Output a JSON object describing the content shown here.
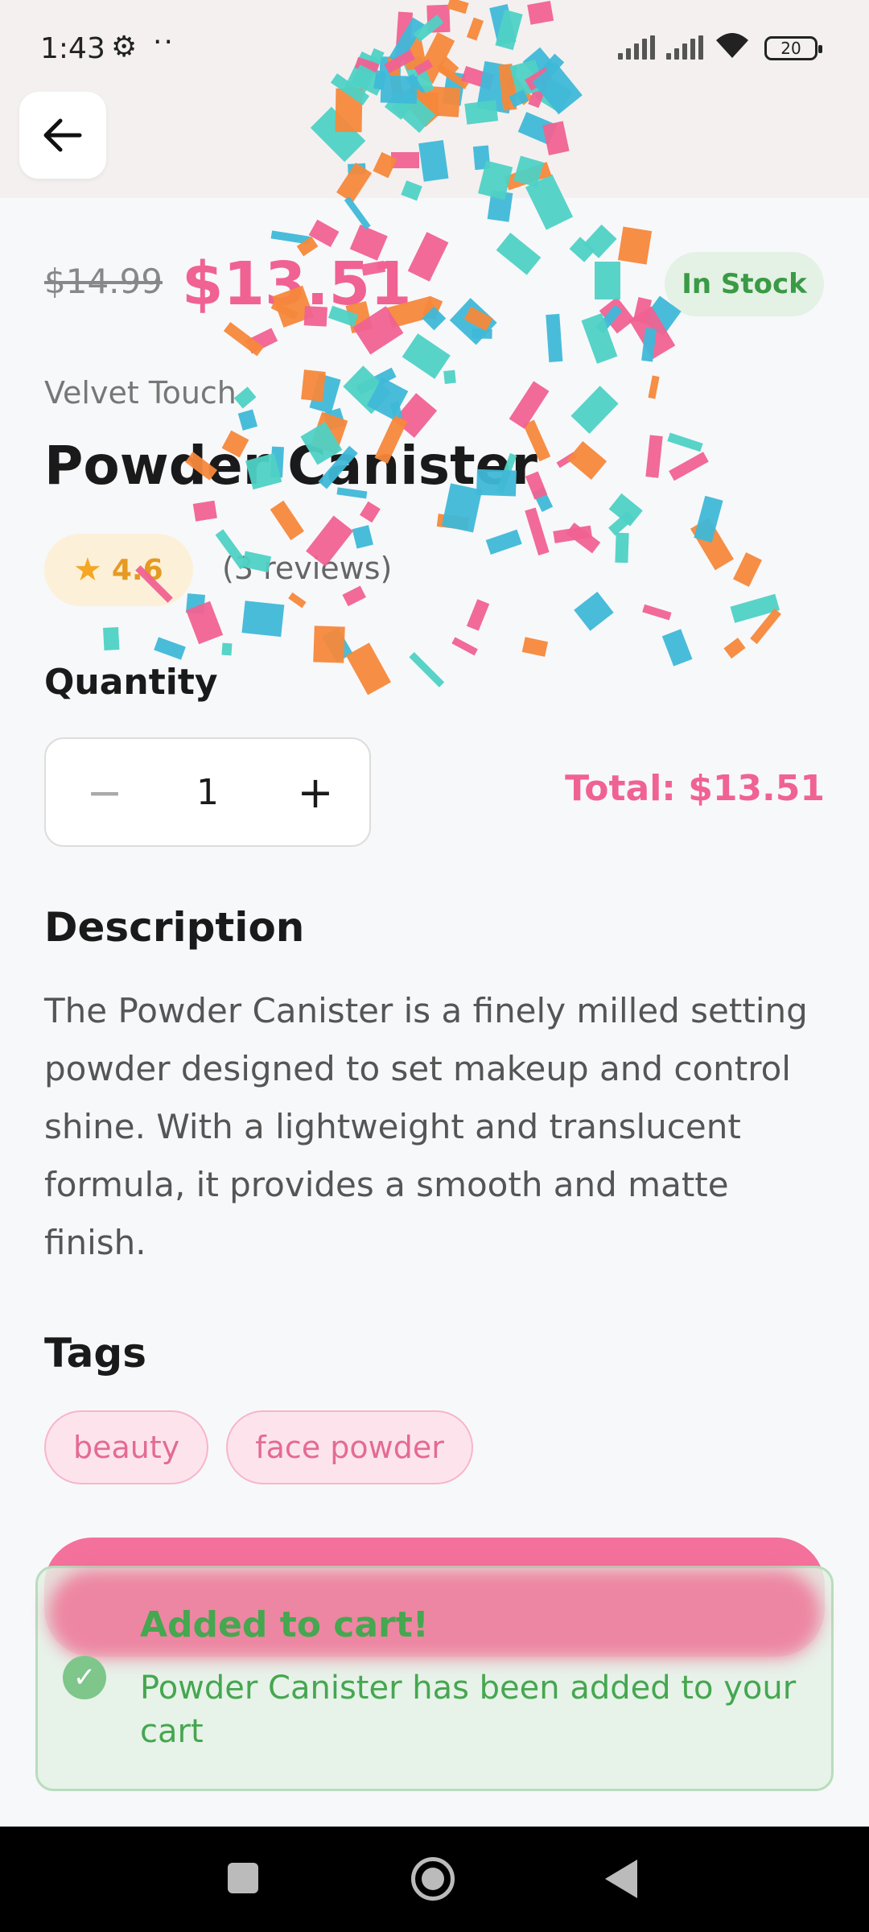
{
  "status_bar": {
    "time": "1:43",
    "settings_icon": "gear-icon",
    "overflow": "··",
    "battery": "20"
  },
  "header": {
    "back_icon": "arrow-left-icon"
  },
  "product": {
    "original_price": "$14.99",
    "price": "$13.51",
    "stock_status": "In Stock",
    "brand": "Velvet Touch",
    "title": "Powder Canister",
    "rating_value": "4.6",
    "reviews": "(3 reviews)"
  },
  "quantity": {
    "label": "Quantity",
    "minus": "−",
    "value": "1",
    "plus": "+",
    "total": "Total: $13.51"
  },
  "description": {
    "title": "Description",
    "text": "The Powder Canister is a finely milled setting powder designed to set makeup and control shine. With a lightweight and translucent formula, it provides a smooth and matte finish."
  },
  "tags": {
    "title": "Tags",
    "items": [
      "beauty",
      "face powder"
    ]
  },
  "toast": {
    "title": "Added to cart!",
    "message": "Powder Canister has been added to your cart"
  },
  "colors": {
    "accent": "#f06292",
    "success": "#45a74f",
    "confetti": [
      "#f06292",
      "#3fb8d8",
      "#f5883b",
      "#4fd1c5"
    ]
  }
}
